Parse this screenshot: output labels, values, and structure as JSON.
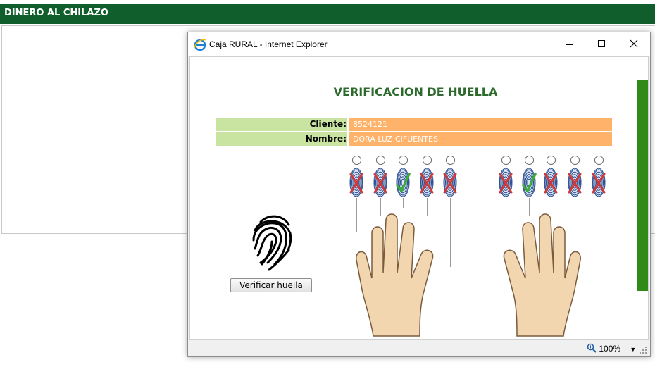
{
  "page": {
    "header_title": "DINERO AL CHILAZO"
  },
  "window": {
    "title": "Caja RURAL - Internet Explorer",
    "zoom": "100%"
  },
  "verification": {
    "title": "VERIFICACION DE HUELLA",
    "client_label": "Cliente:",
    "client_value": "8524121",
    "name_label": "Nombre:",
    "name_value": "DORA LUZ CIFUENTES",
    "verify_button": "Verificar huella",
    "left_hand_fingers": [
      {
        "status": "rejected"
      },
      {
        "status": "rejected"
      },
      {
        "status": "verified"
      },
      {
        "status": "rejected"
      },
      {
        "status": "rejected"
      }
    ],
    "right_hand_fingers": [
      {
        "status": "rejected"
      },
      {
        "status": "verified"
      },
      {
        "status": "rejected"
      },
      {
        "status": "rejected"
      },
      {
        "status": "rejected"
      }
    ]
  },
  "colors": {
    "header": "#0f5e2b",
    "title": "#2d6a2d",
    "label_bg": "#c9e3a0",
    "value_bg": "#ffb36a",
    "reject": "#d23838",
    "verify": "#3caa3c",
    "scrollbar": "#2f8a17"
  }
}
